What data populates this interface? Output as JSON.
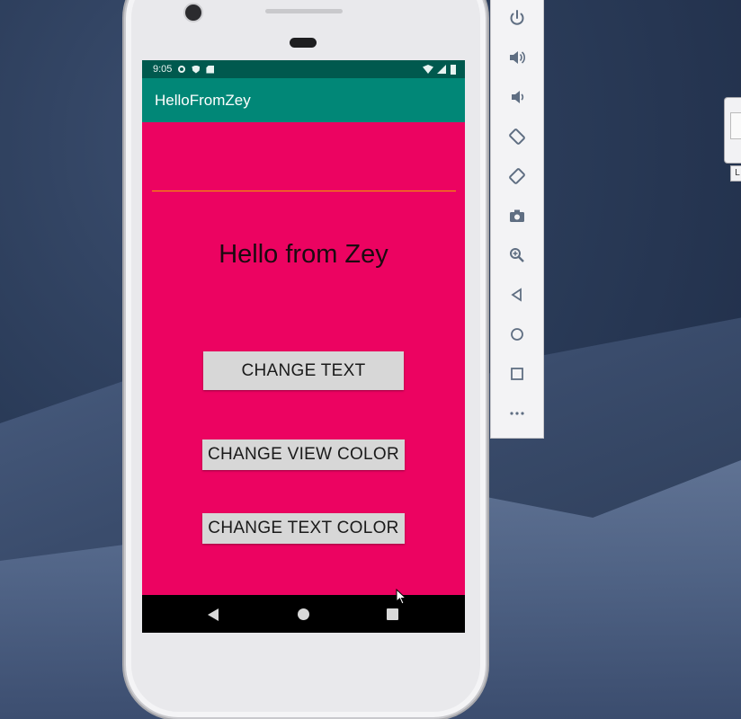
{
  "status_bar": {
    "time": "9:05"
  },
  "app_bar": {
    "title": "HelloFromZey"
  },
  "main": {
    "hello_text": "Hello from Zey",
    "buttons": {
      "change_text": "CHANGE TEXT",
      "change_view_color": "CHANGE VIEW COLOR",
      "change_text_color": "CHANGE TEXT COLOR"
    }
  },
  "colors": {
    "view_background": "#ec0361",
    "app_bar": "#018777",
    "status_bar": "#00594e",
    "divider": "#f3a200"
  },
  "emulator_toolbar": {
    "icons": [
      "power-icon",
      "volume-up-icon",
      "volume-down-icon",
      "rotate-left-icon",
      "rotate-right-icon",
      "camera-icon",
      "zoom-icon",
      "back-icon",
      "home-icon",
      "overview-icon",
      "more-icon"
    ]
  },
  "edge_widget": {
    "label": "L"
  }
}
